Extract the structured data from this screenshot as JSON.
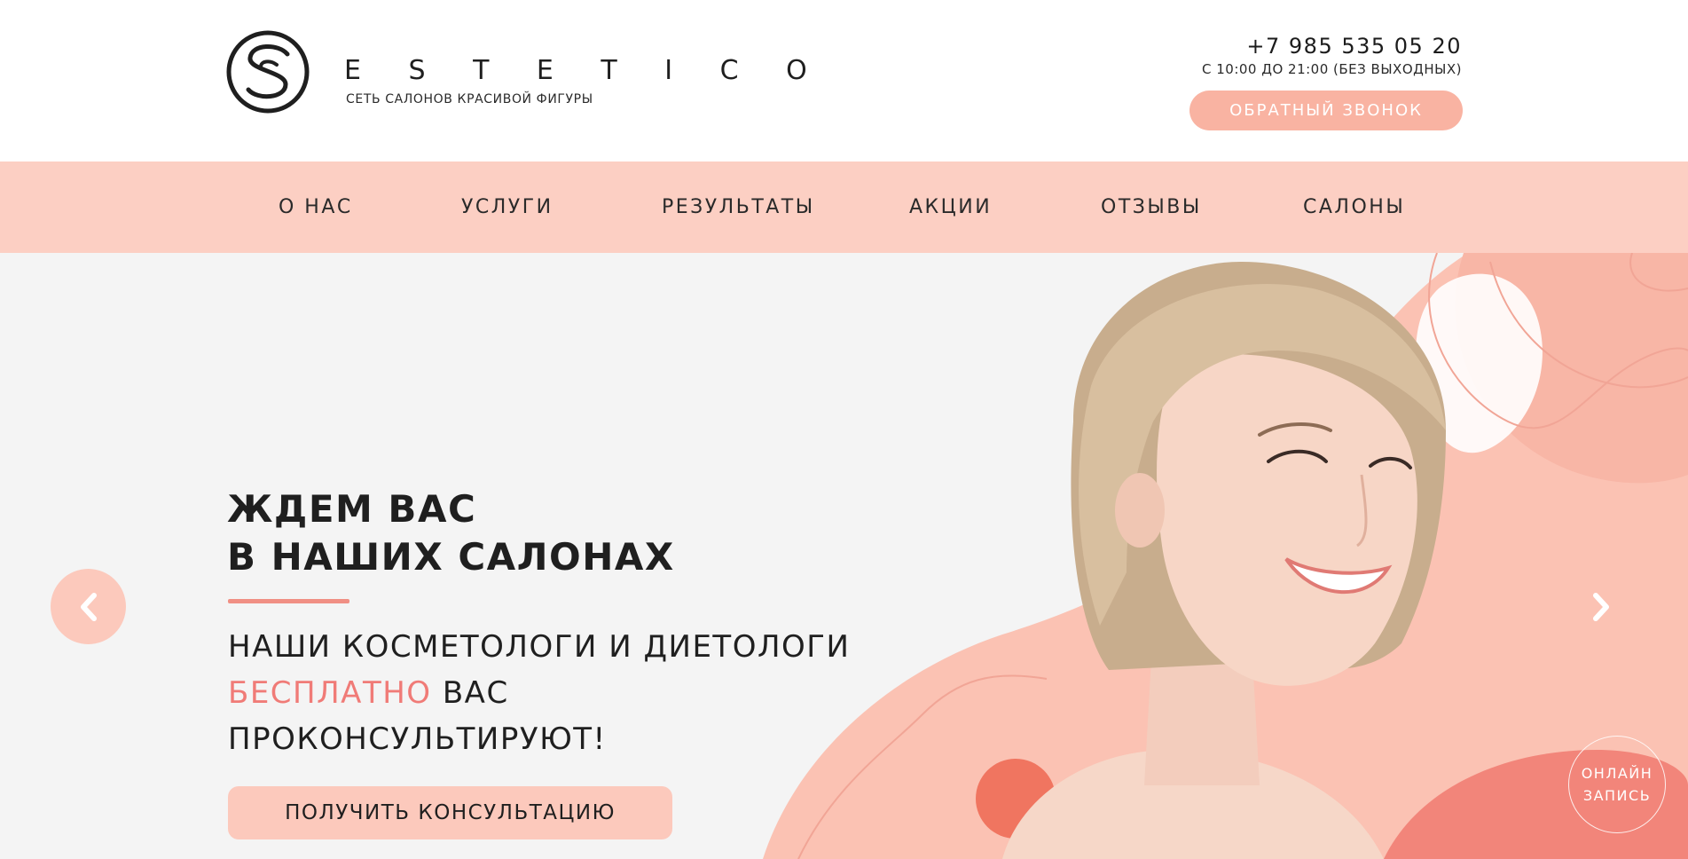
{
  "header": {
    "brand": "E S T E T I C O",
    "tagline": "СЕТЬ САЛОНОВ КРАСИВОЙ ФИГУРЫ",
    "phone": "+7 985 535 05 20",
    "hours": "С 10:00 ДО 21:00 (БЕЗ ВЫХОДНЫХ)",
    "callback_label": "ОБРАТНЫЙ ЗВОНОК",
    "logo_icon": "s-monogram-icon"
  },
  "nav": {
    "items": [
      {
        "label": "О НАС"
      },
      {
        "label": "УСЛУГИ"
      },
      {
        "label": "РЕЗУЛЬТАТЫ"
      },
      {
        "label": "АКЦИИ"
      },
      {
        "label": "ОТЗЫВЫ"
      },
      {
        "label": "САЛОНЫ"
      }
    ]
  },
  "hero": {
    "title_line1": "ЖДЕМ ВАС",
    "title_line2": "В НАШИХ САЛОНАХ",
    "subtitle_line1": "НАШИ КОСМЕТОЛОГИ И ДИЕТОЛОГИ",
    "subtitle_accent": "БЕСПЛАТНО",
    "subtitle_line2_rest": " ВАС",
    "subtitle_line3": "ПРОКОНСУЛЬТИРУЮТ!",
    "cta_label": "ПОЛУЧИТЬ КОНСУЛЬТАЦИЮ",
    "online_line1": "ОНЛАЙН",
    "online_line2": "ЗАПИСЬ",
    "prev_icon": "chevron-left-icon",
    "next_icon": "chevron-right-icon"
  },
  "colors": {
    "nav_bg": "#fccfc3",
    "accent_button": "#f9b3a2",
    "accent_text": "#f07b77",
    "cta_bg": "#fcc9bc",
    "hero_bg": "#f4f4f4",
    "blob": "#fbc2b3",
    "blob_dark": "#f2857a"
  }
}
